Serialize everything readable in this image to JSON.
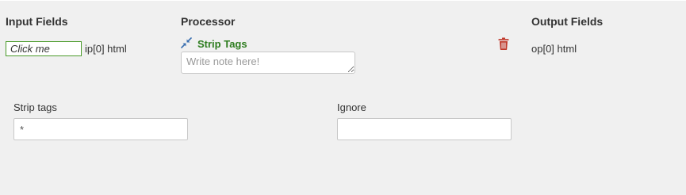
{
  "headers": {
    "input": "Input Fields",
    "processor": "Processor",
    "output": "Output Fields"
  },
  "input_field": {
    "button_label": "Click me",
    "label": "ip[0] html"
  },
  "processor": {
    "icon": "compress-arrows-icon",
    "name": "Strip Tags",
    "note_placeholder": "Write note here!",
    "note_value": ""
  },
  "delete_icon": "trash-icon",
  "output_field": {
    "label": "op[0] html"
  },
  "options": {
    "strip_tags": {
      "label": "Strip tags",
      "value": "*"
    },
    "ignore": {
      "label": "Ignore",
      "value": ""
    }
  },
  "colors": {
    "processor_name": "#2e7d1f",
    "click_box_border": "#4a9a2a",
    "icon_blue": "#3a6fb0",
    "trash_red": "#c0392b",
    "background": "#f0f0f0"
  }
}
